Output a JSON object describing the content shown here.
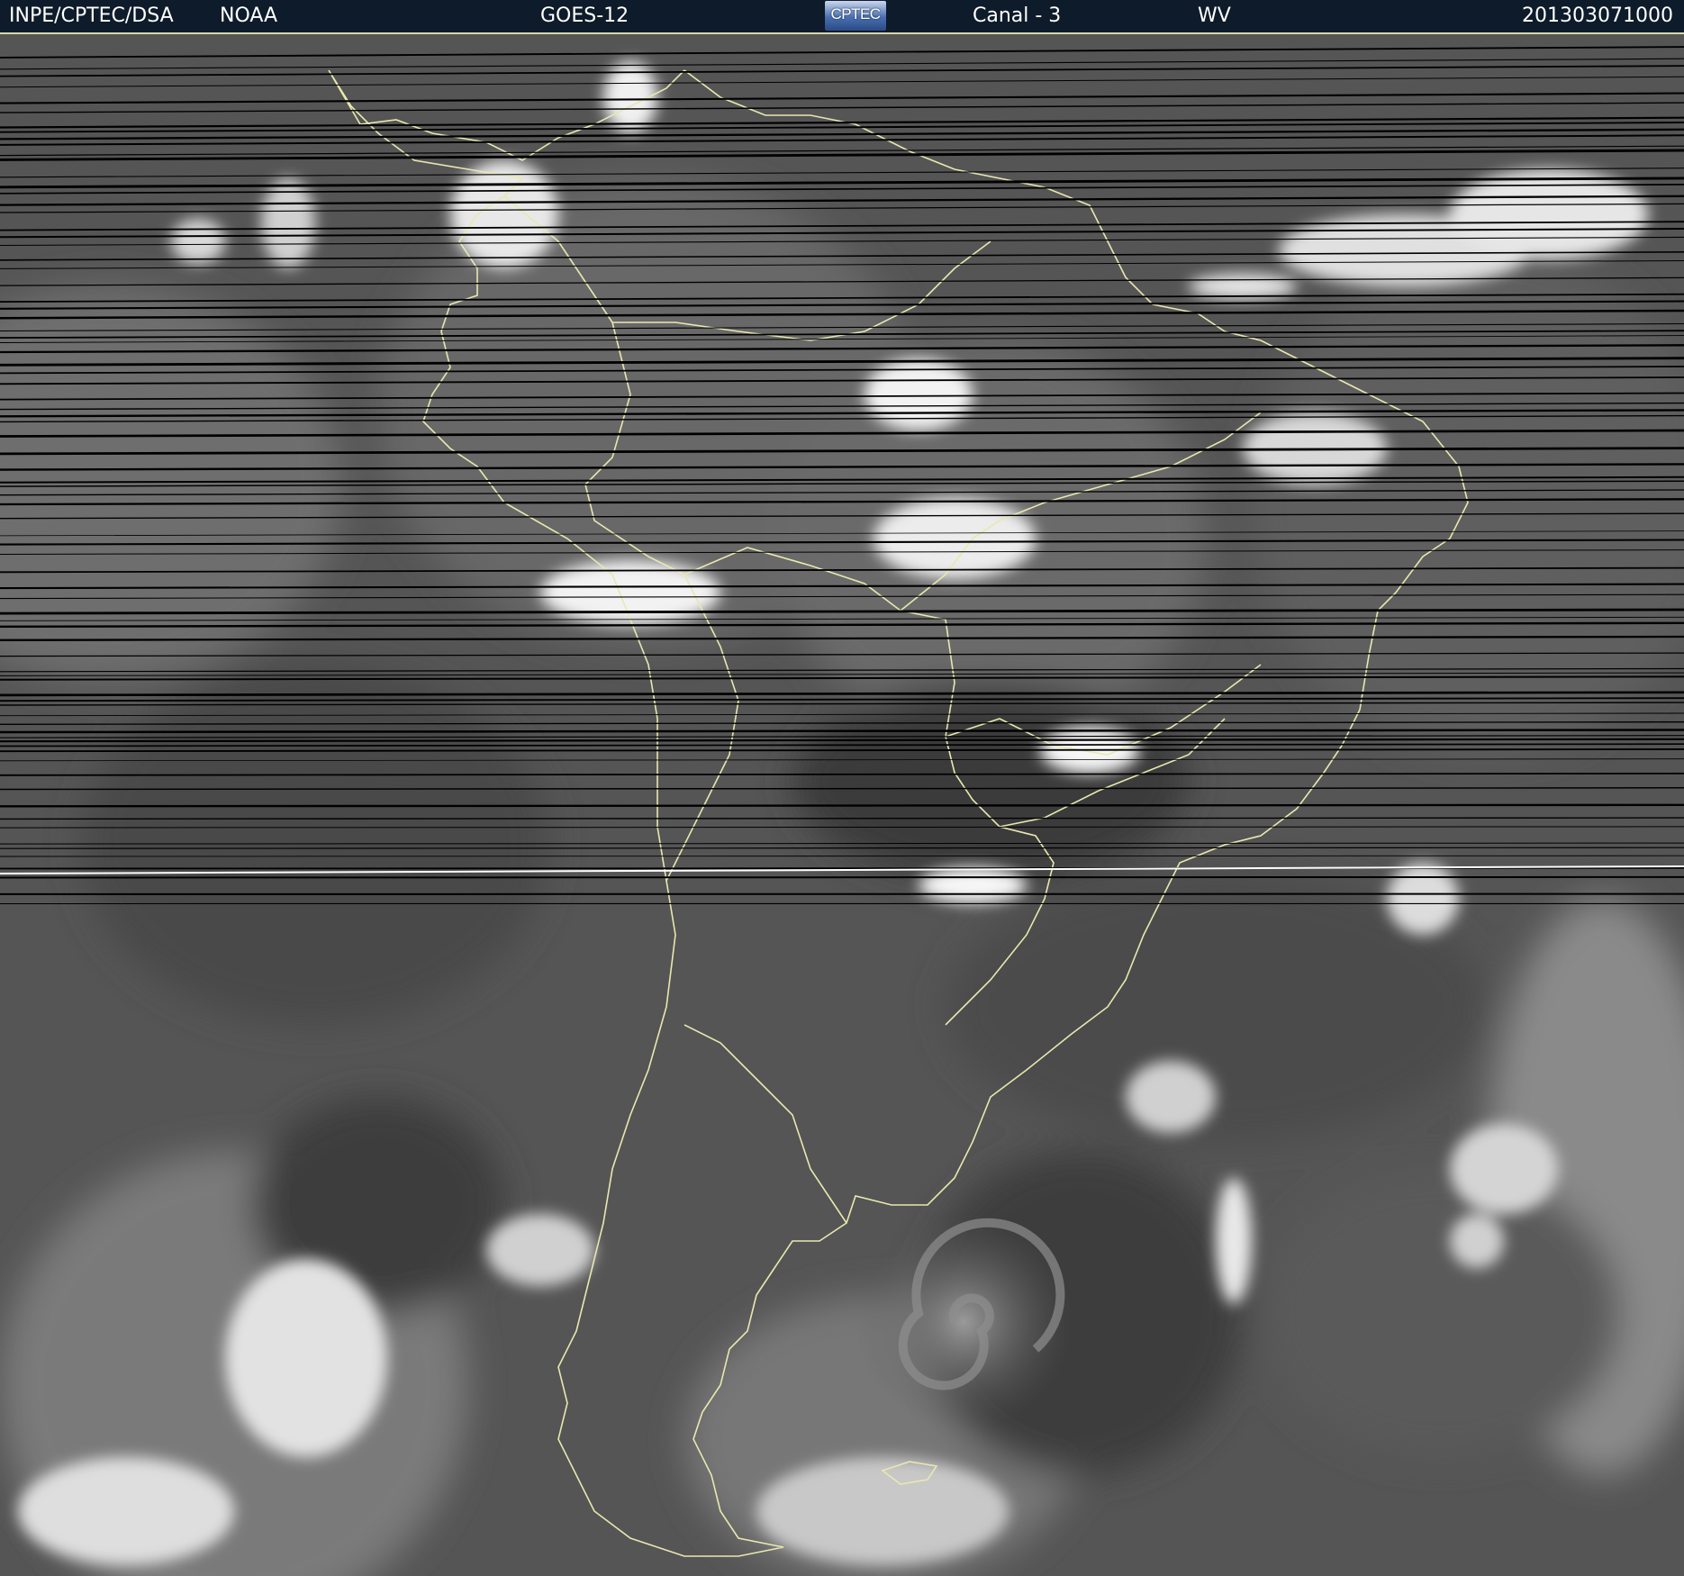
{
  "header": {
    "agency": "INPE/CPTEC/DSA",
    "noaa": "NOAA",
    "satellite": "GOES-12",
    "logo_text": "CPTEC",
    "channel": "Canal - 3",
    "band": "WV",
    "timestamp": "201303071000"
  },
  "colors": {
    "header_bg": "#0d1b2a",
    "coastline": "#e8e8b0",
    "scan_lines": "#000000"
  },
  "icons": {
    "logo": "cptec-logo"
  }
}
